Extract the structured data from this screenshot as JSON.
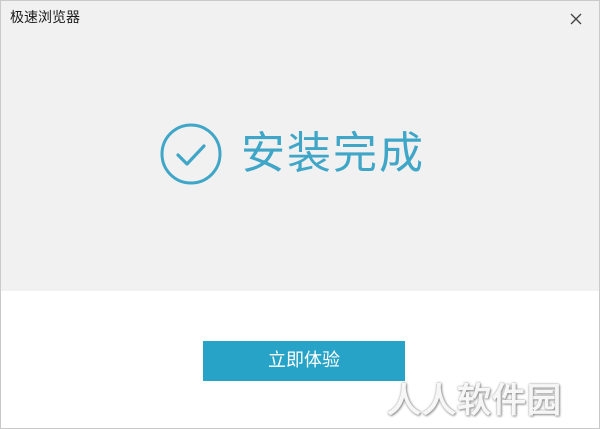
{
  "window": {
    "title": "极速浏览器"
  },
  "status": {
    "message": "安装完成"
  },
  "actions": {
    "start_label": "立即体验"
  },
  "watermark": {
    "text": "人人软件园"
  },
  "icons": {
    "close": "close-icon",
    "check": "check-circle-icon"
  },
  "colors": {
    "accent": "#27a3c7",
    "message": "#3fa6c8",
    "panel_bg": "#f1f1f1"
  }
}
